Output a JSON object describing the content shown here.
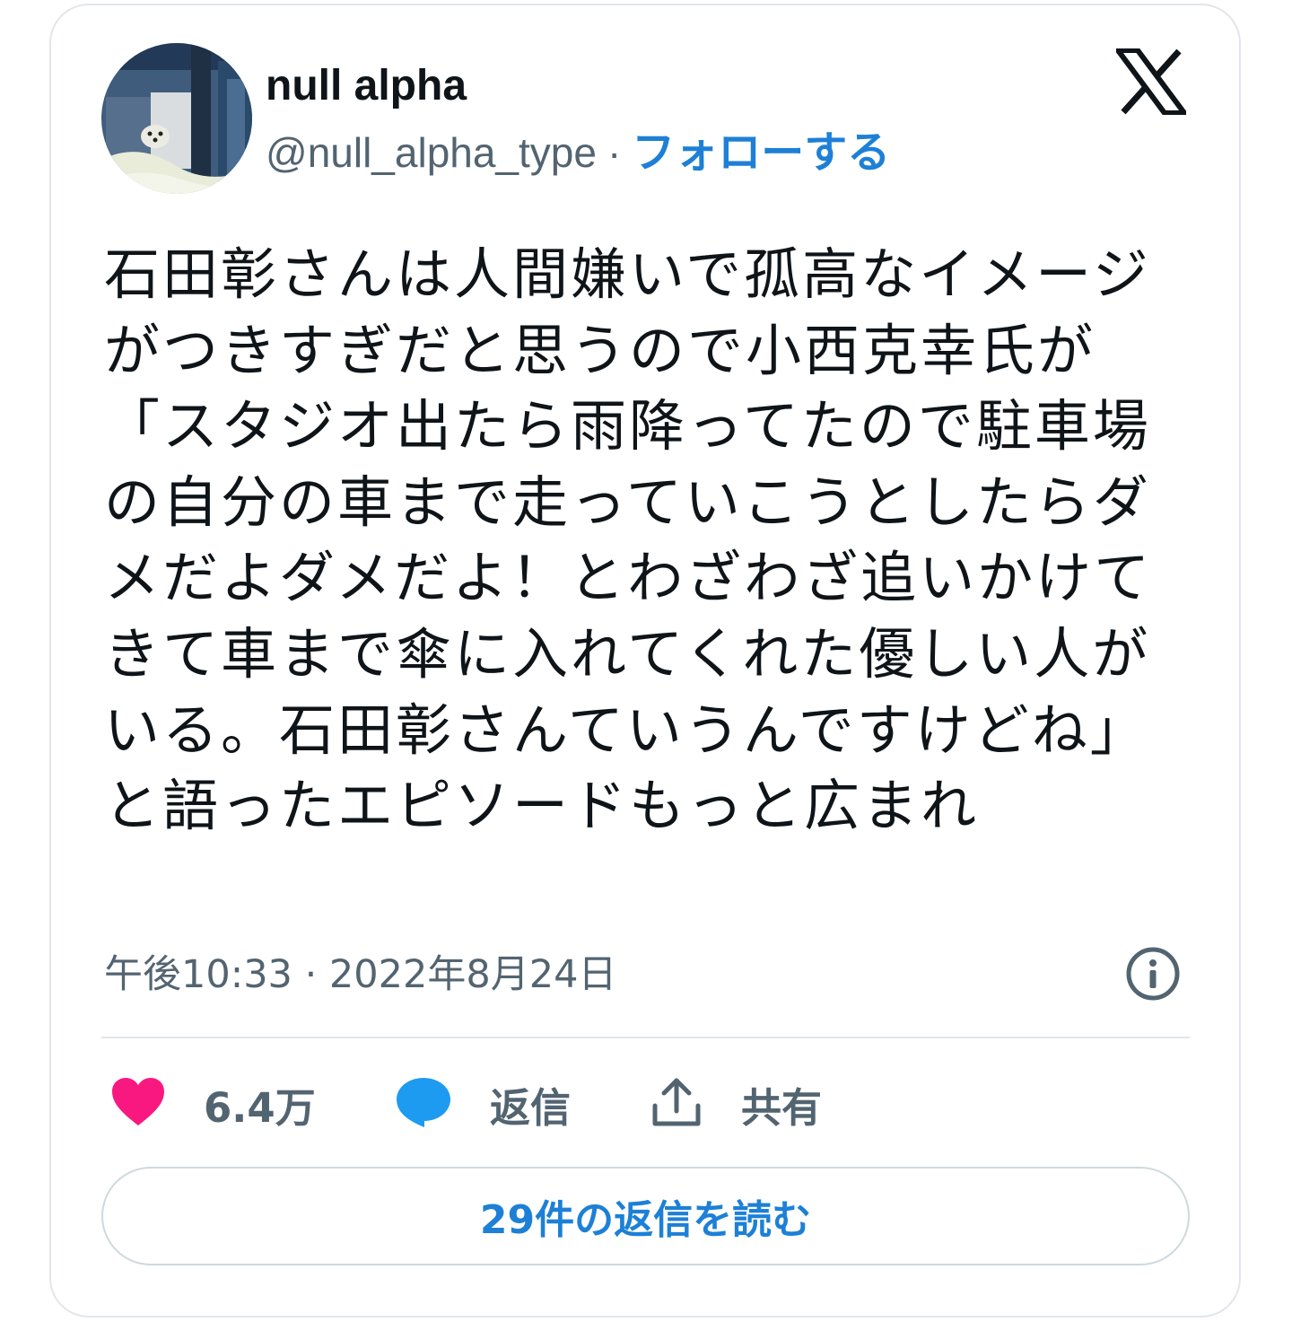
{
  "card": {
    "author": {
      "display_name": "null alpha",
      "handle": "@null_alpha_type",
      "separator": "·",
      "follow_label": "フォローする"
    },
    "text": "石田彰さんは人間嫌いで孤高なイメージがつきすぎだと思うので小西克幸氏が「スタジオ出たら雨降ってたので駐車場の自分の車まで走っていこうとしたらダメだよダメだよ！とわざわざ追いかけてきて車まで傘に入れてくれた優しい人がいる。石田彰さんていうんですけどね」と語ったエピソードもっと広まれ",
    "timestamp": "午後10:33 · 2022年8月24日",
    "actions": {
      "like_count": "6.4万",
      "reply_label": "返信",
      "share_label": "共有"
    },
    "read_replies_label": "29件の返信を読む"
  },
  "colors": {
    "accent": "#1d80d6",
    "like": "#f91880",
    "reply": "#1d9bf0",
    "muted": "#536471",
    "border": "#e2e6ea"
  },
  "icons": {
    "logo": "x-logo-icon",
    "info": "info-icon",
    "like": "heart-icon",
    "reply": "speech-bubble-icon",
    "share": "share-upload-icon"
  }
}
